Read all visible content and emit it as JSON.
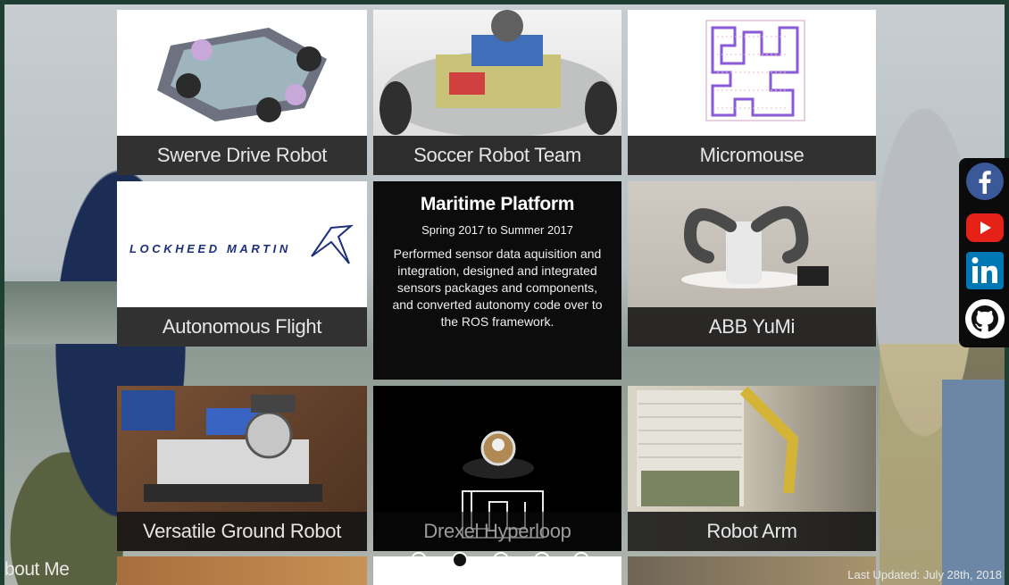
{
  "projects": {
    "swerve": "Swerve Drive Robot",
    "soccer": "Soccer Robot Team",
    "micromouse": "Micromouse",
    "autonomous": "Autonomous Flight",
    "yumi": "ABB YuMi",
    "ground": "Versatile Ground Robot",
    "hyperloop": "Drexel Hyperloop",
    "arm": "Robot Arm"
  },
  "lockheed_logo_text": "LOCKHEED MARTIN",
  "detail": {
    "title": "Maritime Platform",
    "dates": "Spring 2017 to Summer 2017",
    "description": "Performed sensor data aquisition and integration, designed and integrated sensors packages and components, and converted autonomy code over to the ROS framework."
  },
  "social": [
    {
      "name": "facebook-icon",
      "color": "#3b5998"
    },
    {
      "name": "youtube-icon",
      "color": "#e62117"
    },
    {
      "name": "linkedin-icon",
      "color": "#0077b5"
    },
    {
      "name": "github-icon",
      "color": "#ffffff"
    }
  ],
  "pagination": {
    "count": 5,
    "active": 1
  },
  "footer": {
    "about": "bout Me",
    "updated": "Last Updated: July 28th, 2018"
  }
}
